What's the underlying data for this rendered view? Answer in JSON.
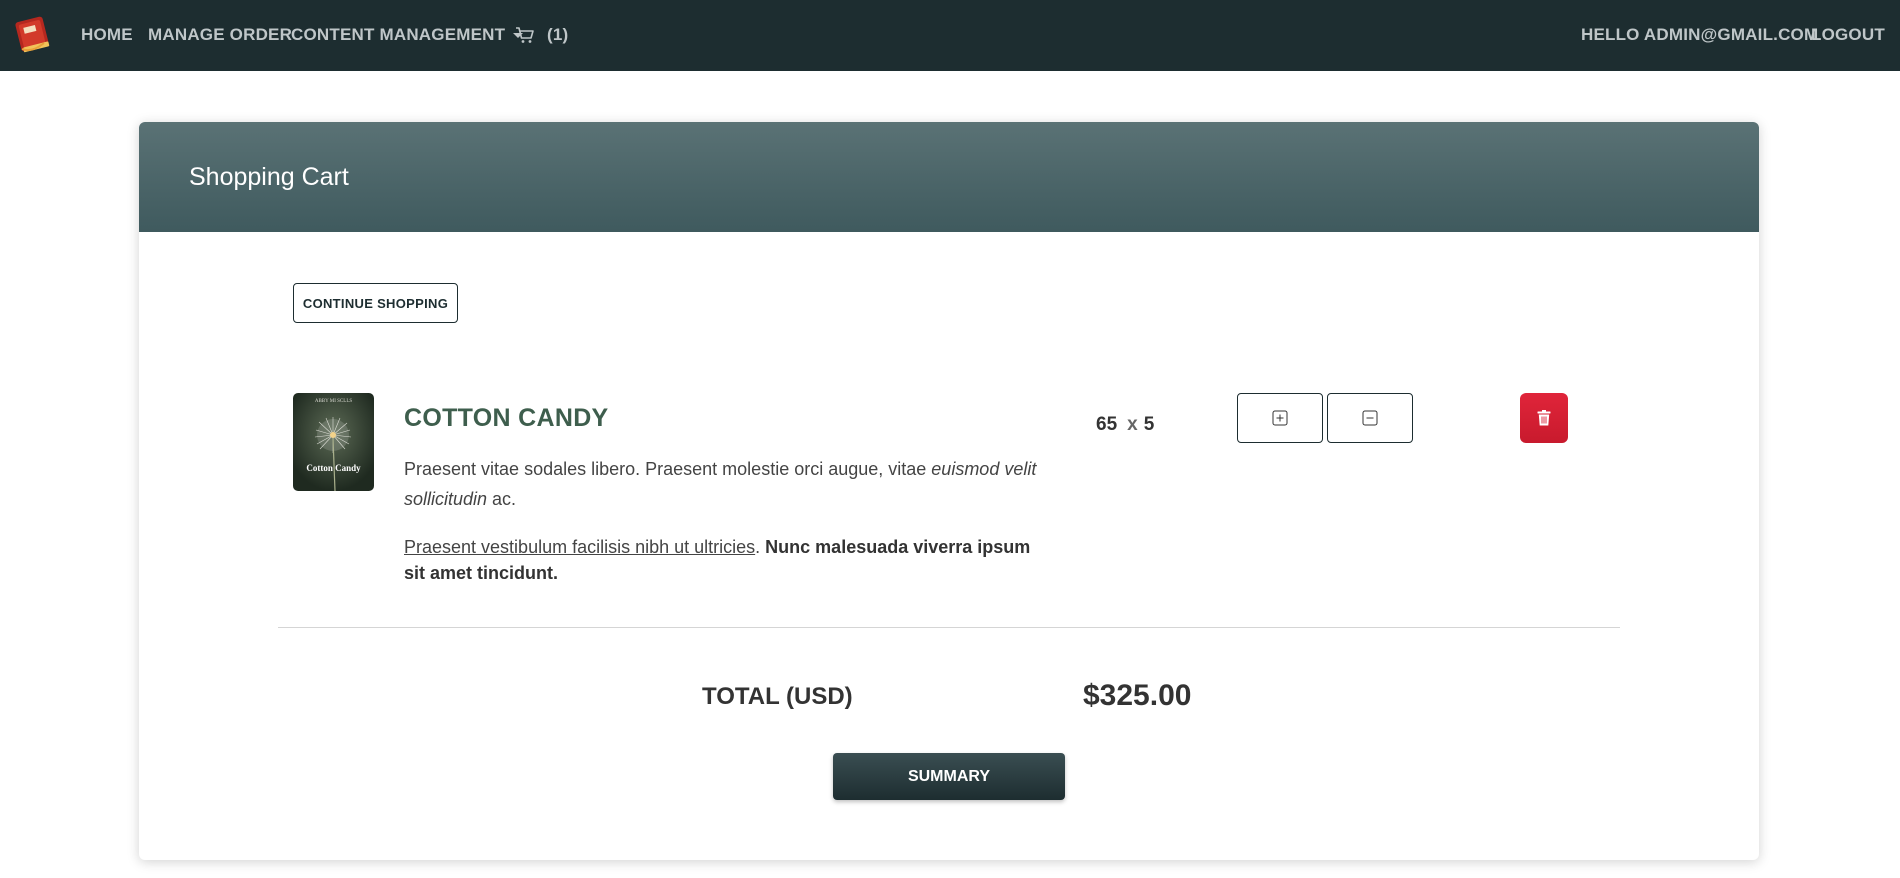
{
  "navbar": {
    "logo_icon": "book-logo-icon",
    "home": "HOME",
    "manage_order": "MANAGE ORDER",
    "content_management": "CONTENT MANAGEMENT",
    "cart_icon": "cart-icon",
    "cart_count": "(1)",
    "greeting": "HELLO ADMIN@GMAIL.COM",
    "logout": "LOGOUT",
    "bg_color": "#1d2d30"
  },
  "card": {
    "title": "Shopping Cart",
    "continue_label": "CONTINUE SHOPPING",
    "header_color": "#4b6568"
  },
  "cart_item": {
    "thumbnail_caption": "Cotton Candy",
    "thumbnail_author": "ABBY MI SCLLS",
    "name": "COTTON CANDY",
    "desc1_plain": "Praesent vitae sodales libero. Praesent molestie orci augue, vitae ",
    "desc1_italic": "euismod velit sollicitudin",
    "desc1_end": " ac.",
    "desc2_underline": "Praesent vestibulum facilisis nibh ut ultricies",
    "desc2_sep": ". ",
    "desc2_bold": "Nunc malesuada viverra ipsum sit amet tincidunt.",
    "price": "65",
    "times": "x",
    "quantity": "5",
    "plus_icon": "plus-square-icon",
    "minus_icon": "minus-square-icon",
    "delete_icon": "trash-icon",
    "delete_color": "#d62035"
  },
  "totals": {
    "label": "TOTAL (USD)",
    "value": "$325.00",
    "summary_label": "SUMMARY"
  }
}
